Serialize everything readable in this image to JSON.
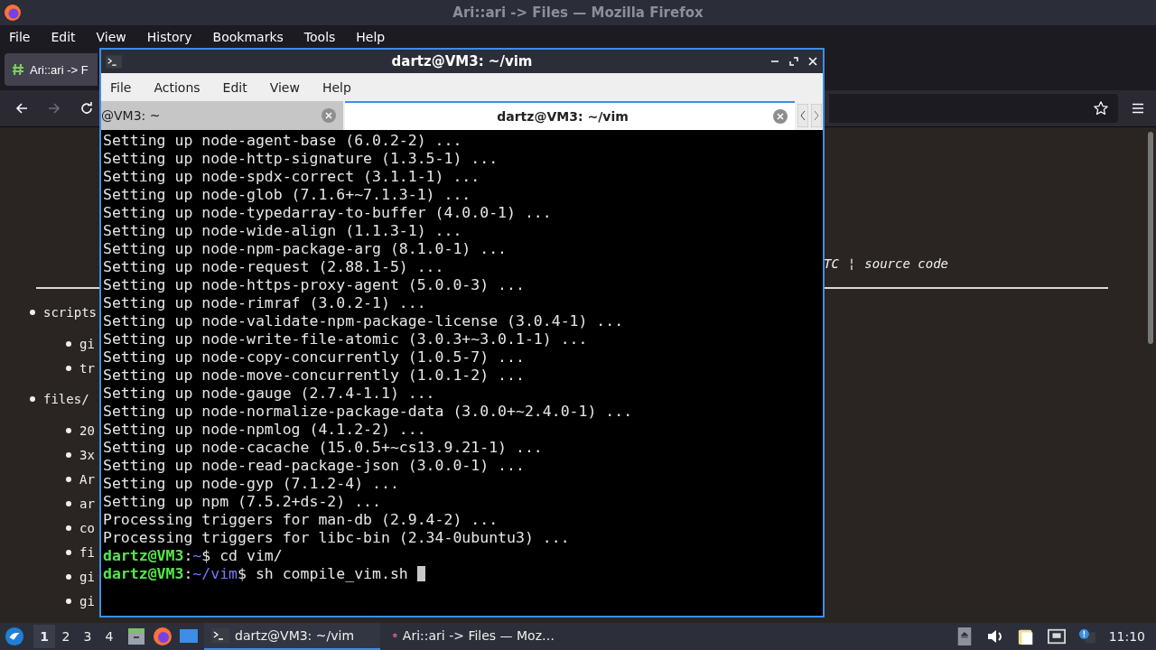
{
  "firefox": {
    "window_title": "Ari::ari -> Files — Mozilla Firefox",
    "menu": [
      "File",
      "Edit",
      "View",
      "History",
      "Bookmarks",
      "Tools",
      "Help"
    ],
    "tab": {
      "label": "Ari::ari -> F"
    },
    "nav": {
      "back_disabled": false,
      "forward_disabled": true
    },
    "page": {
      "header_tail": "TC",
      "header_separator": "¦",
      "header_link": "source code",
      "items": [
        {
          "label": "scripts",
          "children": [
            {
              "label": "gi"
            },
            {
              "label": "tr"
            }
          ]
        },
        {
          "label": "files/",
          "children": [
            {
              "label": "20"
            },
            {
              "label": "3x"
            },
            {
              "label": "Ar"
            },
            {
              "label": "ar"
            },
            {
              "label": "co"
            },
            {
              "label": "fi"
            },
            {
              "label": "gi"
            },
            {
              "label": "gi"
            }
          ]
        }
      ]
    }
  },
  "terminal": {
    "title": "dartz@VM3: ~/vim",
    "menu": [
      "File",
      "Actions",
      "Edit",
      "View",
      "Help"
    ],
    "tabs": [
      {
        "label": "@VM3: ~",
        "selected": false
      },
      {
        "label": "dartz@VM3: ~/vim",
        "selected": true
      }
    ],
    "lines": [
      {
        "kind": "output",
        "text": "Setting up node-agent-base (6.0.2-2) ..."
      },
      {
        "kind": "output",
        "text": "Setting up node-http-signature (1.3.5-1) ..."
      },
      {
        "kind": "output",
        "text": "Setting up node-spdx-correct (3.1.1-1) ..."
      },
      {
        "kind": "output",
        "text": "Setting up node-glob (7.1.6+~7.1.3-1) ..."
      },
      {
        "kind": "output",
        "text": "Setting up node-typedarray-to-buffer (4.0.0-1) ..."
      },
      {
        "kind": "output",
        "text": "Setting up node-wide-align (1.1.3-1) ..."
      },
      {
        "kind": "output",
        "text": "Setting up node-npm-package-arg (8.1.0-1) ..."
      },
      {
        "kind": "output",
        "text": "Setting up node-request (2.88.1-5) ..."
      },
      {
        "kind": "output",
        "text": "Setting up node-https-proxy-agent (5.0.0-3) ..."
      },
      {
        "kind": "output",
        "text": "Setting up node-rimraf (3.0.2-1) ..."
      },
      {
        "kind": "output",
        "text": "Setting up node-validate-npm-package-license (3.0.4-1) ..."
      },
      {
        "kind": "output",
        "text": "Setting up node-write-file-atomic (3.0.3+~3.0.1-1) ..."
      },
      {
        "kind": "output",
        "text": "Setting up node-copy-concurrently (1.0.5-7) ..."
      },
      {
        "kind": "output",
        "text": "Setting up node-move-concurrently (1.0.1-2) ..."
      },
      {
        "kind": "output",
        "text": "Setting up node-gauge (2.7.4-1.1) ..."
      },
      {
        "kind": "output",
        "text": "Setting up node-normalize-package-data (3.0.0+~2.4.0-1) ..."
      },
      {
        "kind": "output",
        "text": "Setting up node-npmlog (4.1.2-2) ..."
      },
      {
        "kind": "output",
        "text": "Setting up node-cacache (15.0.5+~cs13.9.21-1) ..."
      },
      {
        "kind": "output",
        "text": "Setting up node-read-package-json (3.0.0-1) ..."
      },
      {
        "kind": "output",
        "text": "Setting up node-gyp (7.1.2-4) ..."
      },
      {
        "kind": "output",
        "text": "Setting up npm (7.5.2+ds-2) ..."
      },
      {
        "kind": "output",
        "text": "Processing triggers for man-db (2.9.4-2) ..."
      },
      {
        "kind": "output",
        "text": "Processing triggers for libc-bin (2.34-0ubuntu3) ..."
      },
      {
        "kind": "prompt",
        "user": "dartz@VM3",
        "separator": ":",
        "path": "~",
        "symbol": "$",
        "command": "cd vim/"
      },
      {
        "kind": "prompt",
        "user": "dartz@VM3",
        "separator": ":",
        "path": "~/vim",
        "symbol": "$",
        "command": "sh compile_vim.sh"
      }
    ],
    "cursor": true
  },
  "taskbar": {
    "desktops": [
      {
        "label": "1",
        "selected": true
      },
      {
        "label": "2",
        "selected": false
      },
      {
        "label": "3",
        "selected": false
      },
      {
        "label": "4",
        "selected": false
      }
    ],
    "tasks": [
      {
        "label": "dartz@VM3: ~/vim",
        "kind": "terminal",
        "selected": true
      },
      {
        "label": "Ari::ari -> Files — Moz…",
        "kind": "browser",
        "selected": false
      }
    ],
    "clock": "11:10"
  }
}
